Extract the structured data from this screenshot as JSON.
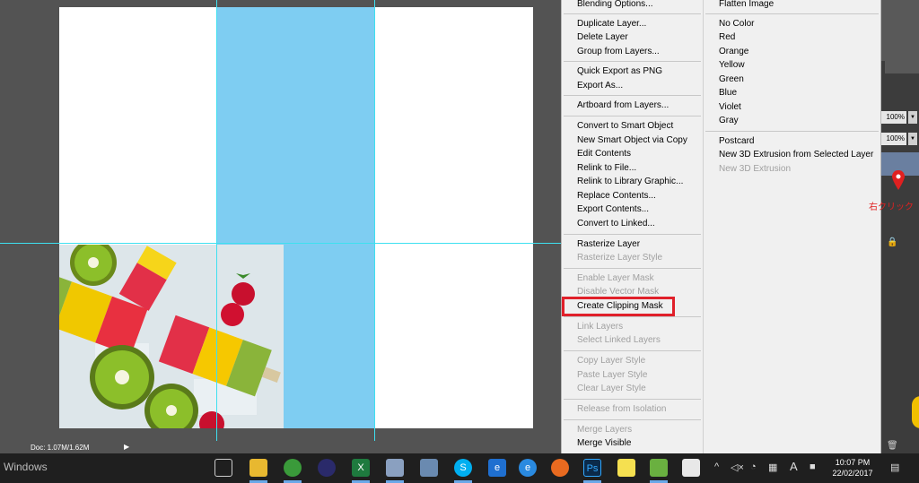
{
  "status": {
    "doc_info": "Doc: 1.07M/1.62M"
  },
  "menu": {
    "col1": [
      {
        "label": "Blending Options...",
        "enabled": true
      },
      {
        "label": "Duplicate Layer...",
        "enabled": true
      },
      {
        "label": "Delete Layer",
        "enabled": true
      },
      {
        "label": "Group from Layers...",
        "enabled": true
      },
      {
        "label": "Quick Export as PNG",
        "enabled": true
      },
      {
        "label": "Export As...",
        "enabled": true
      },
      {
        "label": "Artboard from Layers...",
        "enabled": true
      },
      {
        "label": "Convert to Smart Object",
        "enabled": true
      },
      {
        "label": "New Smart Object via Copy",
        "enabled": true
      },
      {
        "label": "Edit Contents",
        "enabled": true
      },
      {
        "label": "Relink to File...",
        "enabled": true
      },
      {
        "label": "Relink to Library Graphic...",
        "enabled": true
      },
      {
        "label": "Replace Contents...",
        "enabled": true
      },
      {
        "label": "Export Contents...",
        "enabled": true
      },
      {
        "label": "Convert to Linked...",
        "enabled": true
      },
      {
        "label": "Rasterize Layer",
        "enabled": true
      },
      {
        "label": "Rasterize Layer Style",
        "enabled": false
      },
      {
        "label": "Enable Layer Mask",
        "enabled": false
      },
      {
        "label": "Disable Vector Mask",
        "enabled": false
      },
      {
        "label": "Create Clipping Mask",
        "enabled": true
      },
      {
        "label": "Link Layers",
        "enabled": false
      },
      {
        "label": "Select Linked Layers",
        "enabled": false
      },
      {
        "label": "Copy Layer Style",
        "enabled": false
      },
      {
        "label": "Paste Layer Style",
        "enabled": false
      },
      {
        "label": "Clear Layer Style",
        "enabled": false
      },
      {
        "label": "Release from Isolation",
        "enabled": false
      },
      {
        "label": "Merge Layers",
        "enabled": false
      },
      {
        "label": "Merge Visible",
        "enabled": true
      }
    ],
    "col2": [
      {
        "label": "Flatten Image",
        "enabled": true
      },
      {
        "label": "No Color",
        "enabled": true
      },
      {
        "label": "Red",
        "enabled": true
      },
      {
        "label": "Orange",
        "enabled": true
      },
      {
        "label": "Yellow",
        "enabled": true
      },
      {
        "label": "Green",
        "enabled": true
      },
      {
        "label": "Blue",
        "enabled": true
      },
      {
        "label": "Violet",
        "enabled": true
      },
      {
        "label": "Gray",
        "enabled": true
      },
      {
        "label": "Postcard",
        "enabled": true
      },
      {
        "label": "New 3D Extrusion from Selected Layer",
        "enabled": true
      },
      {
        "label": "New 3D Extrusion",
        "enabled": false
      }
    ],
    "highlighted": "Create Clipping Mask"
  },
  "right_panel": {
    "opacity_value": "100%",
    "fill_value": "100%",
    "annotation": "右クリック"
  },
  "taskbar": {
    "windows_label": "Windows",
    "time": "10:07 PM",
    "date": "22/02/2017",
    "ime": "A"
  },
  "colors": {
    "highlight_box": "#e0202a",
    "guide": "#3ee0f0",
    "blue_column": "#7ecdf2"
  }
}
